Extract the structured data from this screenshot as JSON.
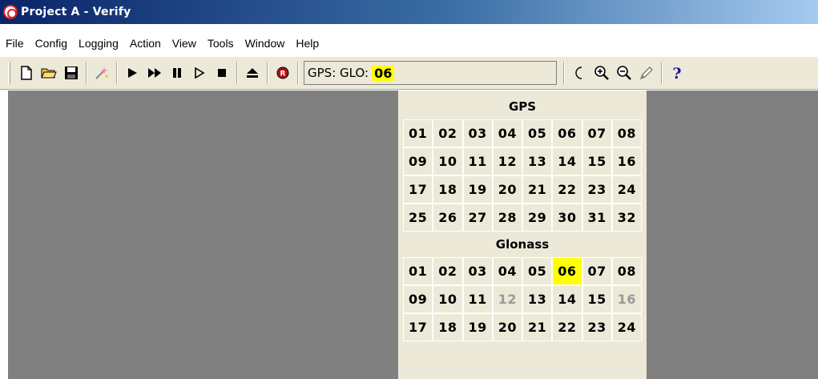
{
  "window": {
    "title": "Project A - Verify"
  },
  "menu": [
    "File",
    "Config",
    "Logging",
    "Action",
    "View",
    "Tools",
    "Window",
    "Help"
  ],
  "satellite_selector": {
    "prefix": "GPS: GLO:",
    "value": "06"
  },
  "gps": {
    "title": "GPS",
    "rows": [
      [
        {
          "n": "01"
        },
        {
          "n": "02"
        },
        {
          "n": "03"
        },
        {
          "n": "04"
        },
        {
          "n": "05"
        },
        {
          "n": "06"
        },
        {
          "n": "07"
        },
        {
          "n": "08"
        }
      ],
      [
        {
          "n": "09"
        },
        {
          "n": "10"
        },
        {
          "n": "11"
        },
        {
          "n": "12"
        },
        {
          "n": "13"
        },
        {
          "n": "14"
        },
        {
          "n": "15"
        },
        {
          "n": "16"
        }
      ],
      [
        {
          "n": "17"
        },
        {
          "n": "18"
        },
        {
          "n": "19"
        },
        {
          "n": "20"
        },
        {
          "n": "21"
        },
        {
          "n": "22"
        },
        {
          "n": "23"
        },
        {
          "n": "24"
        }
      ],
      [
        {
          "n": "25"
        },
        {
          "n": "26"
        },
        {
          "n": "27"
        },
        {
          "n": "28"
        },
        {
          "n": "29"
        },
        {
          "n": "30"
        },
        {
          "n": "31"
        },
        {
          "n": "32"
        }
      ]
    ]
  },
  "glonass": {
    "title": "Glonass",
    "rows": [
      [
        {
          "n": "01"
        },
        {
          "n": "02"
        },
        {
          "n": "03"
        },
        {
          "n": "04"
        },
        {
          "n": "05"
        },
        {
          "n": "06",
          "state": "selected"
        },
        {
          "n": "07"
        },
        {
          "n": "08"
        }
      ],
      [
        {
          "n": "09"
        },
        {
          "n": "10"
        },
        {
          "n": "11"
        },
        {
          "n": "12",
          "state": "disabled"
        },
        {
          "n": "13"
        },
        {
          "n": "14"
        },
        {
          "n": "15"
        },
        {
          "n": "16",
          "state": "disabled"
        }
      ],
      [
        {
          "n": "17"
        },
        {
          "n": "18"
        },
        {
          "n": "19"
        },
        {
          "n": "20"
        },
        {
          "n": "21"
        },
        {
          "n": "22"
        },
        {
          "n": "23"
        },
        {
          "n": "24"
        }
      ]
    ]
  },
  "colors": {
    "selected": "#ffff00",
    "disabled_text": "#9a9a9a",
    "workspace": "#808080"
  },
  "toolbar_icons": [
    "new-file-icon",
    "open-folder-icon",
    "save-icon",
    "wizard-icon",
    "play-icon",
    "fast-forward-icon",
    "pause-icon",
    "step-icon",
    "stop-icon",
    "eject-icon",
    "record-icon",
    "moon-icon",
    "zoom-in-icon",
    "zoom-out-icon",
    "pencil-icon",
    "help-icon"
  ]
}
